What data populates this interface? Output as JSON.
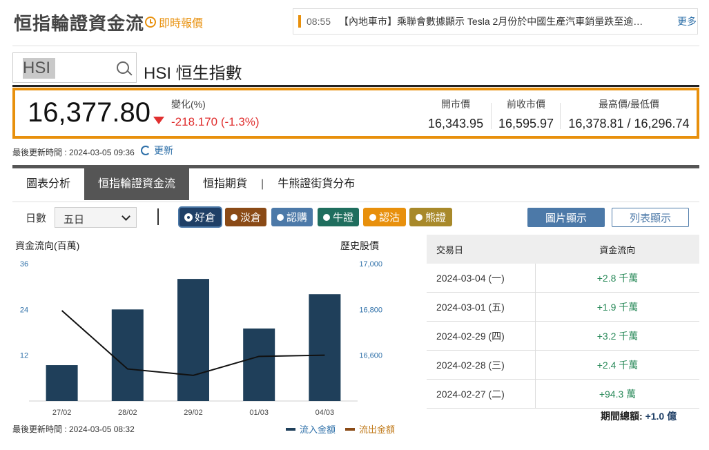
{
  "header": {
    "title": "恒指輪證資金流",
    "realtime_label": "即時報價",
    "news_time": "08:55",
    "news_text": "【內地車市】乘聯會數據顯示 Tesla 2月份於中國生產汽車銷量跌至逾…",
    "news_more": "更多"
  },
  "search": {
    "value": "HSI",
    "index_name": "HSI 恒生指數"
  },
  "quote": {
    "price": "16,377.80",
    "change_label": "變化(%)",
    "change_value": "-218.170 (-1.3%)",
    "open_label": "開市價",
    "open_value": "16,343.95",
    "prev_label": "前收市價",
    "prev_value": "16,595.97",
    "hl_label": "最高價/最低價",
    "hl_value": "16,378.81 / 16,296.74",
    "down_color": "#e03030"
  },
  "update": {
    "text": "最後更新時間 : 2024-03-05 09:36",
    "refresh_label": "更新"
  },
  "tabs": [
    "圖表分析",
    "恒指輪證資金流",
    "恒指期貨",
    "牛熊證街貨分布"
  ],
  "controls": {
    "days_label": "日數",
    "days_value": "五日",
    "filters": [
      {
        "label": "好倉",
        "color": "#1f3f66",
        "selected": true
      },
      {
        "label": "淡倉",
        "color": "#8a4a16",
        "selected": false
      },
      {
        "label": "認購",
        "color": "#4c79a8",
        "selected": false
      },
      {
        "label": "牛證",
        "color": "#1f6e5e",
        "selected": false
      },
      {
        "label": "認沽",
        "color": "#e8900c",
        "selected": false
      },
      {
        "label": "熊證",
        "color": "#a8892a",
        "selected": false
      }
    ],
    "image_view": "圖片顯示",
    "list_view": "列表顯示"
  },
  "chart_data": {
    "type": "bar",
    "left_axis_title": "資金流向(百萬)",
    "right_axis_title": "歷史股價",
    "categories": [
      "27/02",
      "28/02",
      "29/02",
      "01/03",
      "04/03"
    ],
    "bars": {
      "name": "流入金額",
      "values": [
        0.94,
        2.4,
        3.2,
        1.9,
        2.8
      ],
      "color": "#1f3f5a"
    },
    "price_line": {
      "values": [
        16795,
        16540,
        16512,
        16595,
        16600
      ]
    },
    "left_ticks": [
      "36",
      "24",
      "12"
    ],
    "right_ticks": [
      "17,000",
      "16,800",
      "16,600"
    ],
    "left_range": [
      0,
      36
    ],
    "right_range": [
      16400,
      17000
    ],
    "legend": [
      {
        "label": "流入金額",
        "color": "#1f3f5a"
      },
      {
        "label": "流出金額",
        "color": "#8a4a16"
      }
    ],
    "update_text": "最後更新時間 : 2024-03-05 08:32"
  },
  "table": {
    "headers": [
      "交易日",
      "資金流向"
    ],
    "rows": [
      {
        "date": "2024-03-04 (一)",
        "flow": "+2.8 千萬"
      },
      {
        "date": "2024-03-01 (五)",
        "flow": "+1.9 千萬"
      },
      {
        "date": "2024-02-29 (四)",
        "flow": "+3.2 千萬"
      },
      {
        "date": "2024-02-28 (三)",
        "flow": "+2.4 千萬"
      },
      {
        "date": "2024-02-27 (二)",
        "flow": "+94.3 萬"
      }
    ],
    "total_label": "期間總額:",
    "total_value": "+1.0 億"
  }
}
